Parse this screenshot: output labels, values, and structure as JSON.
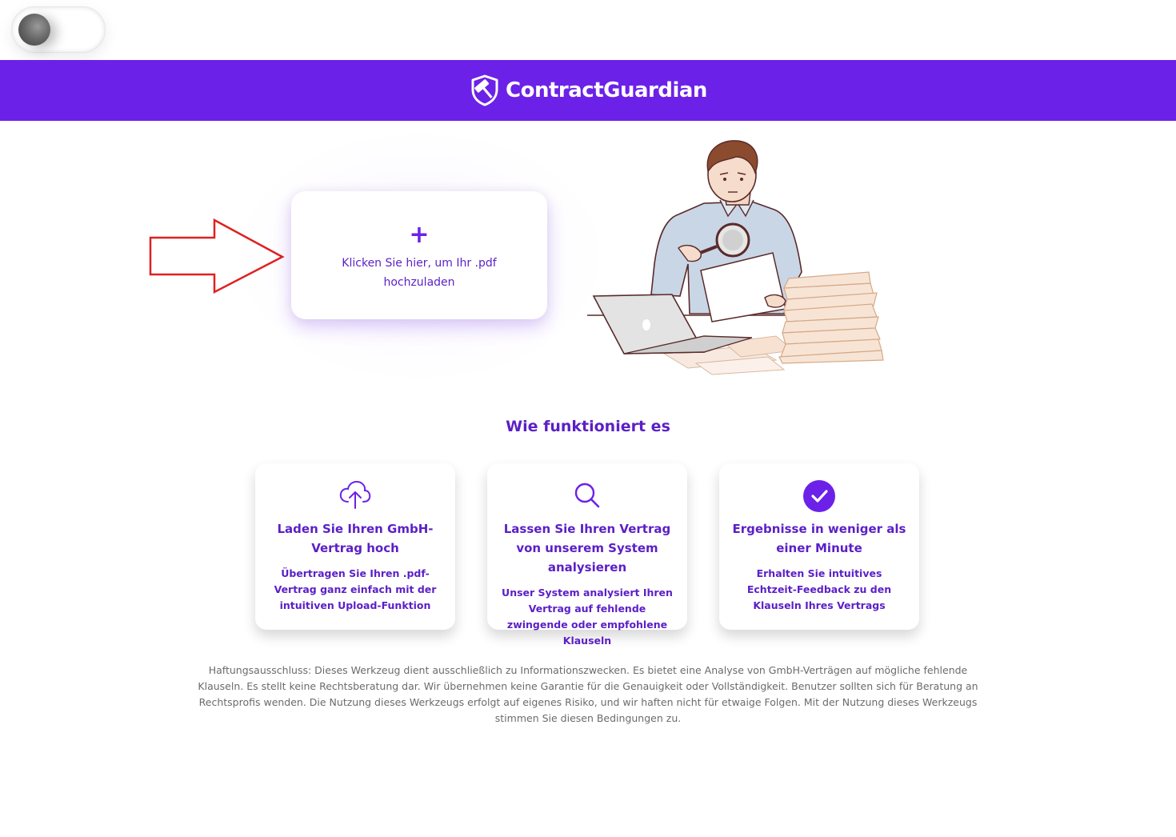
{
  "colors": {
    "brand": "#6c21e8",
    "text_purple": "#5b1fc6",
    "arrow": "#e02020",
    "disclaimer": "#6b6b6b"
  },
  "toggle": {
    "state": "off"
  },
  "header": {
    "brand_name": "ContractGuardian",
    "logo_icon": "shield-gavel-icon"
  },
  "upload": {
    "icon": "plus-icon",
    "plus": "+",
    "label": "Klicken Sie hier, um Ihr .pdf hochzuladen"
  },
  "how": {
    "title": "Wie funktioniert es",
    "steps": [
      {
        "icon": "cloud-upload-icon",
        "title": "Laden Sie Ihren GmbH-Vertrag hoch",
        "desc": "Übertragen Sie Ihren .pdf-Vertrag ganz einfach mit der intuitiven Upload-Funktion"
      },
      {
        "icon": "search-icon",
        "title": "Lassen Sie Ihren Vertrag von unserem System analysieren",
        "desc": "Unser System analysiert Ihren Vertrag auf fehlende zwingende oder empfohlene Klauseln"
      },
      {
        "icon": "check-circle-icon",
        "title": "Ergebnisse in weniger als einer Minute",
        "desc": "Erhalten Sie intuitives Echtzeit-Feedback zu den Klauseln Ihres Vertrags"
      }
    ]
  },
  "disclaimer": "Haftungsausschluss: Dieses Werkzeug dient ausschließlich zu Informationszwecken. Es bietet eine Analyse von GmbH-Verträgen auf mögliche fehlende Klauseln. Es stellt keine Rechtsberatung dar. Wir übernehmen keine Garantie für die Genauigkeit oder Vollständigkeit. Benutzer sollten sich für Beratung an Rechtsprofis wenden. Die Nutzung dieses Werkzeugs erfolgt auf eigenes Risiko, und wir haften nicht für etwaige Folgen. Mit der Nutzung dieses Werkzeugs stimmen Sie diesen Bedingungen zu."
}
